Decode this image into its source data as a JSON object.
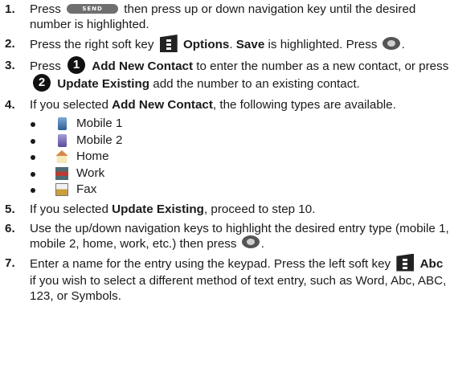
{
  "steps": [
    {
      "num": "1.",
      "before": "Press",
      "send_label": "SEND",
      "after": "then press up or down navigation key until the desired number is highlighted."
    },
    {
      "num": "2.",
      "before": "Press the right soft key",
      "bold1": "Options",
      "mid": ".",
      "bold2": "Save",
      "after": "is highlighted. Press",
      "end": "."
    },
    {
      "num": "3.",
      "before": "Press",
      "key1": "1",
      "bold1": "Add New Contact",
      "mid": "to enter the number as a new contact, or press",
      "key2": "2",
      "bold2": "Update Existing",
      "after": "add the number to an existing contact."
    },
    {
      "num": "4.",
      "before": "If you selected",
      "bold1": "Add New Contact",
      "after": ", the following types are available."
    },
    {
      "num": "5.",
      "before": "If you selected",
      "bold1": "Update Existing",
      "after": ", proceed to step 10."
    },
    {
      "num": "6.",
      "before": "Use the up/down navigation keys to highlight the desired entry type (mobile 1, mobile 2, home, work, etc.) then press",
      "end": "."
    },
    {
      "num": "7.",
      "before": "Enter a name for the entry using the keypad. Press the left soft key",
      "bold1": "Abc",
      "after": "if you wish to select a different method of text entry, such as Word, Abc, ABC, 123, or Symbols."
    }
  ],
  "contact_types": [
    {
      "label": "Mobile 1",
      "icon": "mobile1-icon"
    },
    {
      "label": "Mobile 2",
      "icon": "mobile2-icon"
    },
    {
      "label": "Home",
      "icon": "home-icon"
    },
    {
      "label": "Work",
      "icon": "work-icon"
    },
    {
      "label": "Fax",
      "icon": "fax-icon"
    }
  ]
}
